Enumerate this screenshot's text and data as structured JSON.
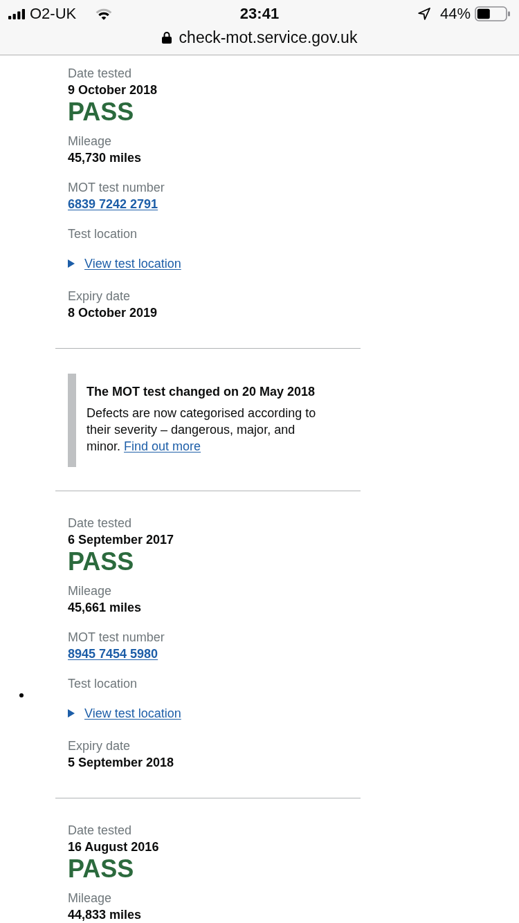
{
  "status_bar": {
    "carrier": "O2-UK",
    "time": "23:41",
    "battery": "44%"
  },
  "address_bar": {
    "url": "check-mot.service.gov.uk"
  },
  "sections": [
    {
      "kind": "test",
      "items": [
        {
          "kind": "field",
          "label": "Date tested",
          "value": "9 October 2018"
        },
        {
          "kind": "result",
          "text": "PASS"
        },
        {
          "kind": "field",
          "label": "Mileage",
          "value": "45,730 miles"
        },
        {
          "kind": "link_field",
          "label": "MOT test number",
          "value": "6839 7242 2791"
        },
        {
          "kind": "details",
          "label": "Test location",
          "summary": "View test location",
          "expanded": false
        },
        {
          "kind": "field",
          "label": "Expiry date",
          "value": "8 October 2019"
        }
      ]
    },
    {
      "kind": "notice",
      "title": "The MOT test changed on 20 May 2018",
      "text": "Defects are now categorised according to their severity – dangerous, major, and minor.",
      "link": "Find out more"
    },
    {
      "kind": "test",
      "items": [
        {
          "kind": "field",
          "label": "Date tested",
          "value": "6 September 2017"
        },
        {
          "kind": "result",
          "text": "PASS"
        },
        {
          "kind": "field",
          "label": "Mileage",
          "value": "45,661 miles"
        },
        {
          "kind": "link_field",
          "label": "MOT test number",
          "value": "8945 7454 5980"
        },
        {
          "kind": "details",
          "label": "Test location",
          "summary": "View test location",
          "expanded": false
        },
        {
          "kind": "field",
          "label": "Expiry date",
          "value": "5 September 2018"
        }
      ]
    },
    {
      "kind": "test",
      "items": [
        {
          "kind": "field",
          "label": "Date tested",
          "value": "16 August 2016"
        },
        {
          "kind": "result",
          "text": "PASS"
        },
        {
          "kind": "field",
          "label": "Mileage",
          "value": "44,833 miles"
        }
      ]
    }
  ]
}
